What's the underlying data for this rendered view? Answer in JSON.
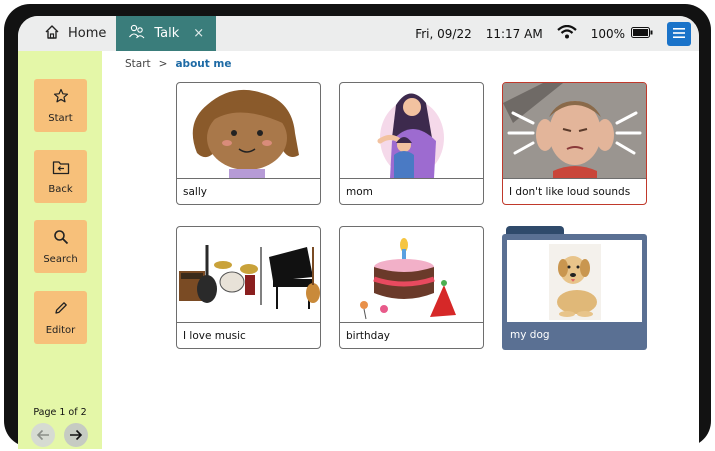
{
  "tabs": {
    "home_label": "Home",
    "talk_label": "Talk",
    "talk_close": "×"
  },
  "status": {
    "date": "Fri, 09/22",
    "time": "11:17 AM",
    "battery": "100%",
    "wifi_icon": "wifi-icon",
    "battery_icon": "battery-icon"
  },
  "sidebar": {
    "items": [
      {
        "label": "Start",
        "icon": "star-icon"
      },
      {
        "label": "Back",
        "icon": "back-folder-icon"
      },
      {
        "label": "Search",
        "icon": "search-icon"
      },
      {
        "label": "Editor",
        "icon": "pencil-icon"
      }
    ],
    "page_info": "Page 1 of 2"
  },
  "breadcrumb": {
    "root": "Start",
    "separator": ">",
    "current": "about me"
  },
  "tiles": [
    {
      "label": "sally"
    },
    {
      "label": "mom"
    },
    {
      "label": "I don't like loud sounds"
    },
    {
      "label": "I love music"
    },
    {
      "label": "birthday"
    }
  ],
  "folder": {
    "label": "my dog"
  },
  "colors": {
    "topbar": "#eceded",
    "talk_tab": "#3a7d7b",
    "sidebar": "#e4f7a8",
    "sidebar_button": "#f7c07a",
    "menu_button": "#1a73c9",
    "folder": "#5a7093",
    "breadcrumb_current": "#1d6aa5"
  }
}
